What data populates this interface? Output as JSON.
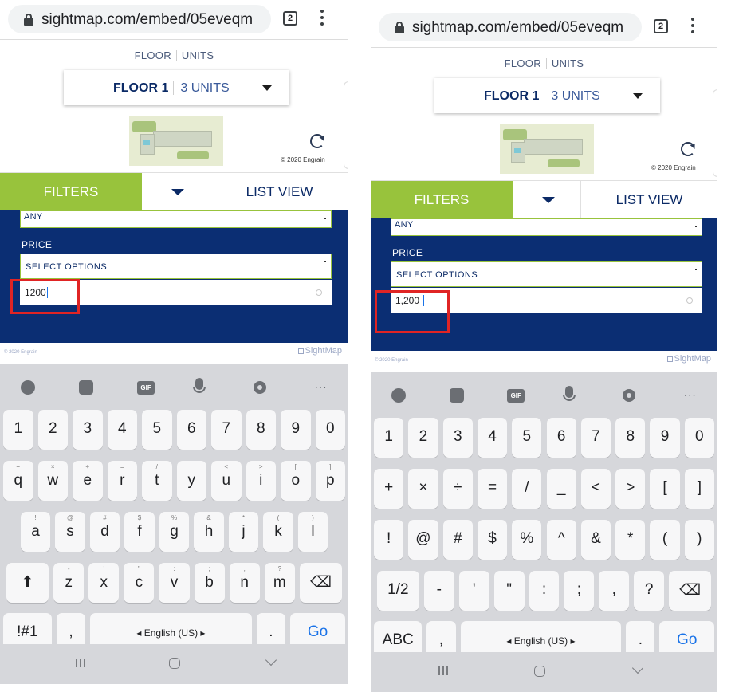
{
  "browser": {
    "url": "sightmap.com/embed/05eveqm",
    "tab_count": "2"
  },
  "sightmap": {
    "mode_floor": "FLOOR",
    "mode_units": "UNITS",
    "floor_label": "FLOOR 1",
    "units_label": "3 UNITS",
    "copyright_top": "© 2020 Engrain",
    "filters_button": "FILTERS",
    "list_view_button": "LIST VIEW",
    "any_select": "ANY",
    "price_label": "PRICE",
    "price_select": "SELECT OPTIONS",
    "copyright_bottom": "© 2020 Engrain",
    "logo_text": "SightMap"
  },
  "left": {
    "price_input_value": "1200",
    "rows": [
      {
        "keys": [
          {
            "main": "1"
          },
          {
            "main": "2"
          },
          {
            "main": "3"
          },
          {
            "main": "4"
          },
          {
            "main": "5"
          },
          {
            "main": "6"
          },
          {
            "main": "7"
          },
          {
            "main": "8"
          },
          {
            "main": "9"
          },
          {
            "main": "0"
          }
        ]
      },
      {
        "keys": [
          {
            "main": "q",
            "sup": "+"
          },
          {
            "main": "w",
            "sup": "×"
          },
          {
            "main": "e",
            "sup": "÷"
          },
          {
            "main": "r",
            "sup": "="
          },
          {
            "main": "t",
            "sup": "/"
          },
          {
            "main": "y",
            "sup": "_"
          },
          {
            "main": "u",
            "sup": "<"
          },
          {
            "main": "i",
            "sup": ">"
          },
          {
            "main": "o",
            "sup": "["
          },
          {
            "main": "p",
            "sup": "]"
          }
        ]
      },
      {
        "keys": [
          {
            "main": "a",
            "sup": "!"
          },
          {
            "main": "s",
            "sup": "@"
          },
          {
            "main": "d",
            "sup": "#"
          },
          {
            "main": "f",
            "sup": "$"
          },
          {
            "main": "g",
            "sup": "%"
          },
          {
            "main": "h",
            "sup": "&"
          },
          {
            "main": "j",
            "sup": "*"
          },
          {
            "main": "k",
            "sup": "("
          },
          {
            "main": "l",
            "sup": ")"
          }
        ]
      },
      {
        "keys": [
          {
            "main": "⬆"
          },
          {
            "main": "z",
            "sup": "-"
          },
          {
            "main": "x",
            "sup": "'"
          },
          {
            "main": "c",
            "sup": "\""
          },
          {
            "main": "v",
            "sup": ":"
          },
          {
            "main": "b",
            "sup": ";"
          },
          {
            "main": "n",
            "sup": ","
          },
          {
            "main": "m",
            "sup": "?"
          },
          {
            "main": "⌫"
          }
        ]
      },
      {
        "keys": [
          {
            "main": "!#1"
          },
          {
            "main": ","
          },
          {
            "main": "◂  English (US)  ▸"
          },
          {
            "main": "."
          },
          {
            "main": "Go"
          }
        ]
      }
    ]
  },
  "right": {
    "price_input_value": "1,200",
    "rows": [
      {
        "keys": [
          {
            "main": "1"
          },
          {
            "main": "2"
          },
          {
            "main": "3"
          },
          {
            "main": "4"
          },
          {
            "main": "5"
          },
          {
            "main": "6"
          },
          {
            "main": "7"
          },
          {
            "main": "8"
          },
          {
            "main": "9"
          },
          {
            "main": "0"
          }
        ]
      },
      {
        "keys": [
          {
            "main": "+"
          },
          {
            "main": "×"
          },
          {
            "main": "÷"
          },
          {
            "main": "="
          },
          {
            "main": "/"
          },
          {
            "main": "_"
          },
          {
            "main": "<"
          },
          {
            "main": ">"
          },
          {
            "main": "["
          },
          {
            "main": "]"
          }
        ]
      },
      {
        "keys": [
          {
            "main": "!"
          },
          {
            "main": "@"
          },
          {
            "main": "#"
          },
          {
            "main": "$"
          },
          {
            "main": "%"
          },
          {
            "main": "^"
          },
          {
            "main": "&"
          },
          {
            "main": "*"
          },
          {
            "main": "("
          },
          {
            "main": ")"
          }
        ]
      },
      {
        "keys": [
          {
            "main": "1/2"
          },
          {
            "main": "-"
          },
          {
            "main": "'"
          },
          {
            "main": "\""
          },
          {
            "main": ":"
          },
          {
            "main": ";"
          },
          {
            "main": ","
          },
          {
            "main": "?"
          },
          {
            "main": "⌫"
          }
        ]
      },
      {
        "keys": [
          {
            "main": "ABC"
          },
          {
            "main": ","
          },
          {
            "main": "◂  English (US)  ▸"
          },
          {
            "main": "."
          },
          {
            "main": "Go"
          }
        ]
      }
    ]
  },
  "toolbar_icons": [
    "emoji-icon",
    "sticker-icon",
    "gif-icon",
    "mic-icon",
    "gear-icon",
    "more-icon"
  ],
  "toolbar_gif_label": "GIF",
  "toolbar_more_label": "···",
  "colors": {
    "filter_green": "#98c33c",
    "panel_blue": "#0b2e73",
    "highlight_red": "#e02424",
    "go_blue": "#1a73e8"
  }
}
